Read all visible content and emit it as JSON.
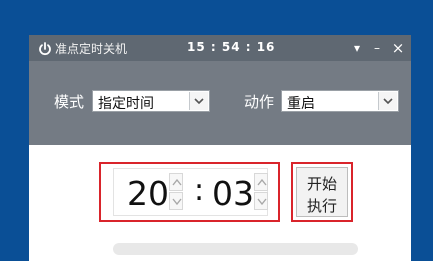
{
  "titlebar": {
    "app_title": "准点定时关机",
    "clock": "15 : 54 : 16",
    "icons": [
      "power-icon",
      "menu-icon",
      "minimize-icon",
      "close-icon"
    ],
    "menu_glyph": "▾",
    "minimize_glyph": "–",
    "close_glyph": "×"
  },
  "controls": {
    "mode_label": "模式",
    "mode_value": "指定时间",
    "action_label": "动作",
    "action_value": "重启"
  },
  "timer": {
    "hour": "20",
    "separator": ":",
    "minute": "03"
  },
  "start_button": {
    "line1": "开始",
    "line2": "执行"
  },
  "progress": {
    "fraction": 0
  },
  "colors": {
    "desktop": "#0a4f96",
    "titlebar": "#5f6872",
    "controls_panel": "#747b84",
    "highlight_border": "#d9242b"
  }
}
